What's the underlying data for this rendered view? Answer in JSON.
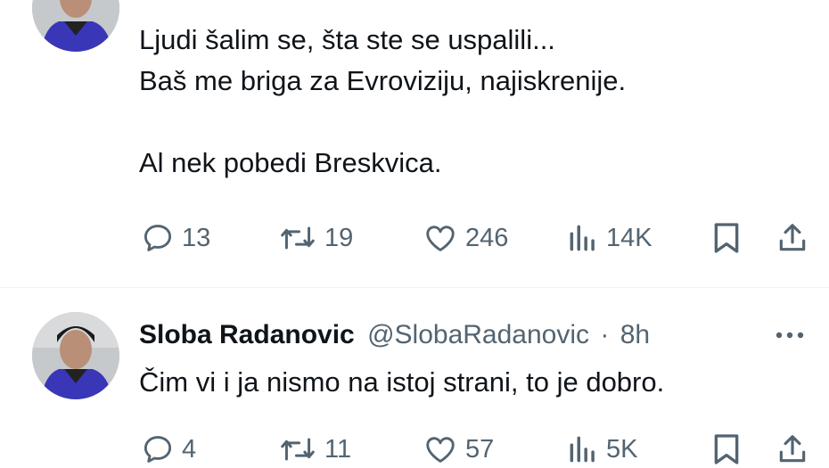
{
  "tweets": [
    {
      "author": {
        "name": "",
        "handle": "",
        "time": ""
      },
      "text_lines": [
        "Ljudi šalim se, šta ste se uspalili...",
        "Baš me briga za Evroviziju, najiskrenije.",
        "",
        "Al nek pobedi Breskvica."
      ],
      "actions": {
        "replies": "13",
        "reposts": "19",
        "likes": "246",
        "views": "14K"
      }
    },
    {
      "author": {
        "name": "Sloba Radanovic",
        "handle": "@SlobaRadanovic",
        "separator": "·",
        "time": "8h"
      },
      "text_lines": [
        "Čim vi i ja nismo na istoj strani, to je dobro."
      ],
      "actions": {
        "replies": "4",
        "reposts": "11",
        "likes": "57",
        "views": "5K"
      }
    }
  ],
  "icons": {
    "reply": "reply-icon",
    "repost": "repost-icon",
    "like": "like-icon",
    "views": "views-icon",
    "bookmark": "bookmark-icon",
    "share": "share-icon",
    "more": "more-icon"
  },
  "colors": {
    "text": "#0f1419",
    "muted": "#536471",
    "divider": "#eff3f4"
  }
}
